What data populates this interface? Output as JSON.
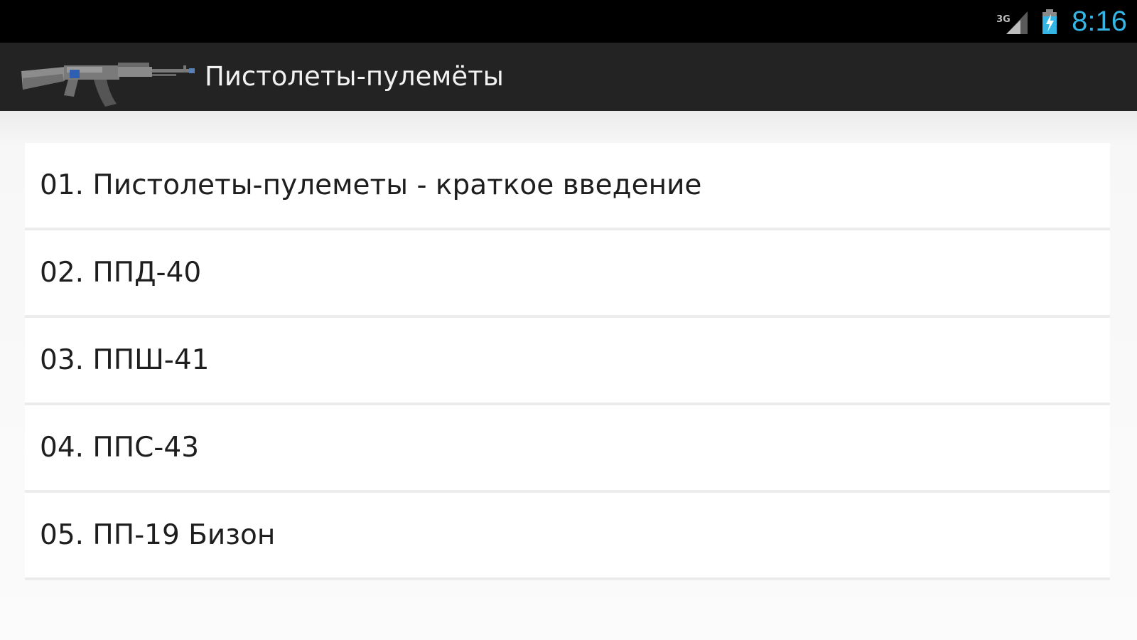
{
  "status_bar": {
    "network_type": "3G",
    "time": "8:16",
    "icons": [
      "signal-icon",
      "battery-charging-icon"
    ],
    "clock_color": "#33b5e5"
  },
  "action_bar": {
    "title": "Пистолеты-пулемёты",
    "logo_icon": "rifle-icon",
    "background": "#232323"
  },
  "list": {
    "items": [
      {
        "label": "01. Пистолеты-пулеметы - краткое введение"
      },
      {
        "label": "02. ППД-40"
      },
      {
        "label": "03. ППШ-41"
      },
      {
        "label": "04. ППС-43"
      },
      {
        "label": "05. ПП-19 Бизон"
      }
    ]
  }
}
